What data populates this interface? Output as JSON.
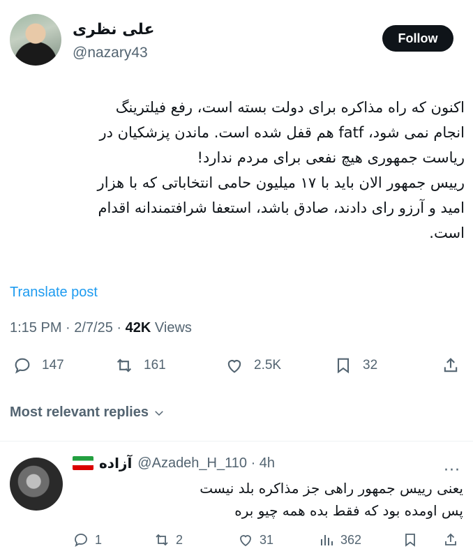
{
  "author": {
    "display_name": "علی نظری",
    "handle": "@nazary43"
  },
  "follow_label": "Follow",
  "tweet": {
    "text": "اکنون که راه مذاکره برای دولت بسته است، رفع فیلترینگ\nانجام نمی شود، fatf هم قفل شده است. ماندن پزشکیان در\nریاست جمهوری هیچ نفعی برای مردم ندارد!\nرییس جمهور الان باید با ۱۷ میلیون حامی انتخاباتی که با هزار\nامید و آرزو رای دادند، صادق باشد، استعفا شرافتمندانه اقدام\nاست.",
    "translate_label": "Translate post",
    "time": "1:15 PM · 2/7/25 · ",
    "views_count": "42K",
    "views_label": " Views"
  },
  "stats": {
    "replies": "147",
    "retweets": "161",
    "likes": "2.5K",
    "bookmarks": "32"
  },
  "sort_label": "Most relevant replies",
  "reply": {
    "name": "آزاده",
    "handle_time": "@Azadeh_H_110 · 4h",
    "text": "یعنی رییس جمهور راهی جز مذاکره بلد نیست\nپس اومده بود که فقط بده همه چیو بره",
    "replies": "1",
    "retweets": "2",
    "likes": "31",
    "views": "362"
  },
  "icons": {
    "reply": "speech-bubble-icon",
    "retweet": "retweet-icon",
    "like": "heart-icon",
    "bookmark": "bookmark-icon",
    "share": "share-icon",
    "views": "bar-chart-icon",
    "more": "more-icon",
    "flag": "iran-flag-icon",
    "chevron": "chevron-down-icon"
  },
  "colors": {
    "accent": "#1d9bf0",
    "text": "#0f1419",
    "muted": "#536471",
    "follow_bg": "#0f1419"
  }
}
